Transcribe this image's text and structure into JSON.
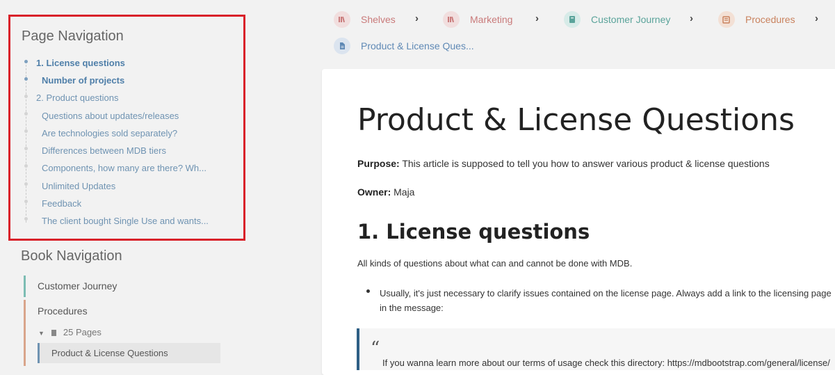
{
  "page_nav": {
    "title": "Page Navigation",
    "items": [
      {
        "label": "1. License questions"
      },
      {
        "label": "Number of projects"
      },
      {
        "label": "2. Product questions"
      },
      {
        "label": "Questions about updates/releases"
      },
      {
        "label": "Are technologies sold separately?"
      },
      {
        "label": "Differences between MDB tiers"
      },
      {
        "label": "Components, how many are there? Wh..."
      },
      {
        "label": "Unlimited Updates"
      },
      {
        "label": "Feedback"
      },
      {
        "label": "The client bought Single Use and wants..."
      }
    ]
  },
  "book_nav": {
    "title": "Book Navigation",
    "journey": "Customer Journey",
    "procedures": "Procedures",
    "pages_count": "25 Pages",
    "current_page": "Product & License Questions"
  },
  "breadcrumbs": {
    "shelves": "Shelves",
    "marketing": "Marketing",
    "customer_journey": "Customer Journey",
    "procedures": "Procedures",
    "page": "Product & License Ques..."
  },
  "icons": {
    "shelves": "shelves-icon",
    "book": "book-icon",
    "chapter": "chapter-icon",
    "page": "page-icon"
  },
  "colors": {
    "shelf": "#c97a7a",
    "book": "#5aa39a",
    "chapter": "#c9825e",
    "page": "#5f89b5",
    "highlight_border": "#d9222a",
    "quote_border": "#2e5f85"
  },
  "content": {
    "title": "Product & License Questions",
    "purpose_label": "Purpose:",
    "purpose_text": " This article is supposed to tell you how to answer various product & license questions",
    "owner_label": "Owner:",
    "owner_text": " Maja",
    "section_heading": "1. License questions",
    "section_intro": "All kinds of questions about what can and cannot be done with MDB.",
    "bullet_text": "Usually, it's just necessary to clarify issues contained on the license page. Always add a link to the licensing page in the message:",
    "quote_mark": "“",
    "quote_text": "If you wanna learn more about our terms of usage check this directory: https://mdbootstrap.com/general/license/"
  }
}
